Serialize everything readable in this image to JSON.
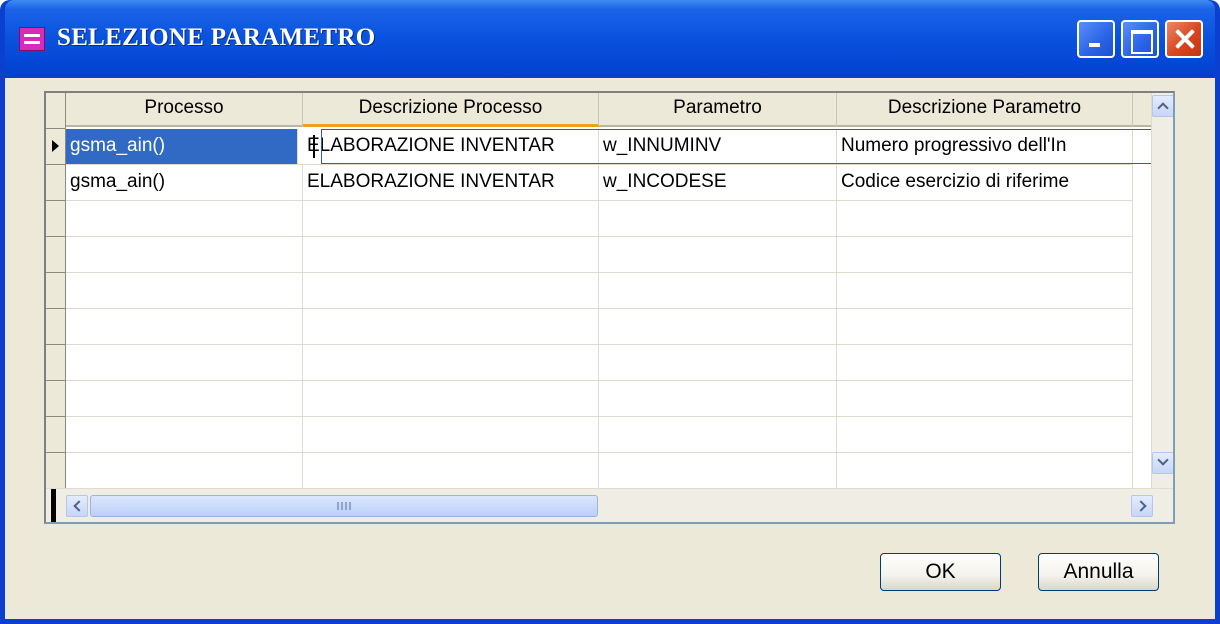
{
  "window": {
    "title": "SELEZIONE PARAMETRO",
    "title_bar_color": "#0a54e0"
  },
  "grid": {
    "columns": [
      "Processo",
      "Descrizione Processo",
      "Parametro",
      "Descrizione Parametro"
    ],
    "rows": [
      [
        "gsma_ain()",
        "ELABORAZIONE INVENTAR",
        "w_INNUMINV",
        "Numero progressivo dell'In"
      ],
      [
        "gsma_ain()",
        "ELABORAZIONE INVENTAR",
        "w_INCODESE",
        "Codice esercizio di riferime"
      ]
    ],
    "selected_row": 0,
    "selection_color": "#316ac5"
  },
  "buttons": {
    "ok_label": "OK",
    "cancel_label": "Annulla"
  },
  "icons": {
    "app": "form-icon",
    "minimize": "minimize-icon",
    "maximize": "maximize-icon",
    "close": "close-icon",
    "row_pointer": "row-pointer-icon",
    "scroll_up": "scroll-up-icon",
    "scroll_down": "scroll-down-icon",
    "scroll_left": "scroll-left-icon",
    "scroll_right": "scroll-right-icon"
  }
}
